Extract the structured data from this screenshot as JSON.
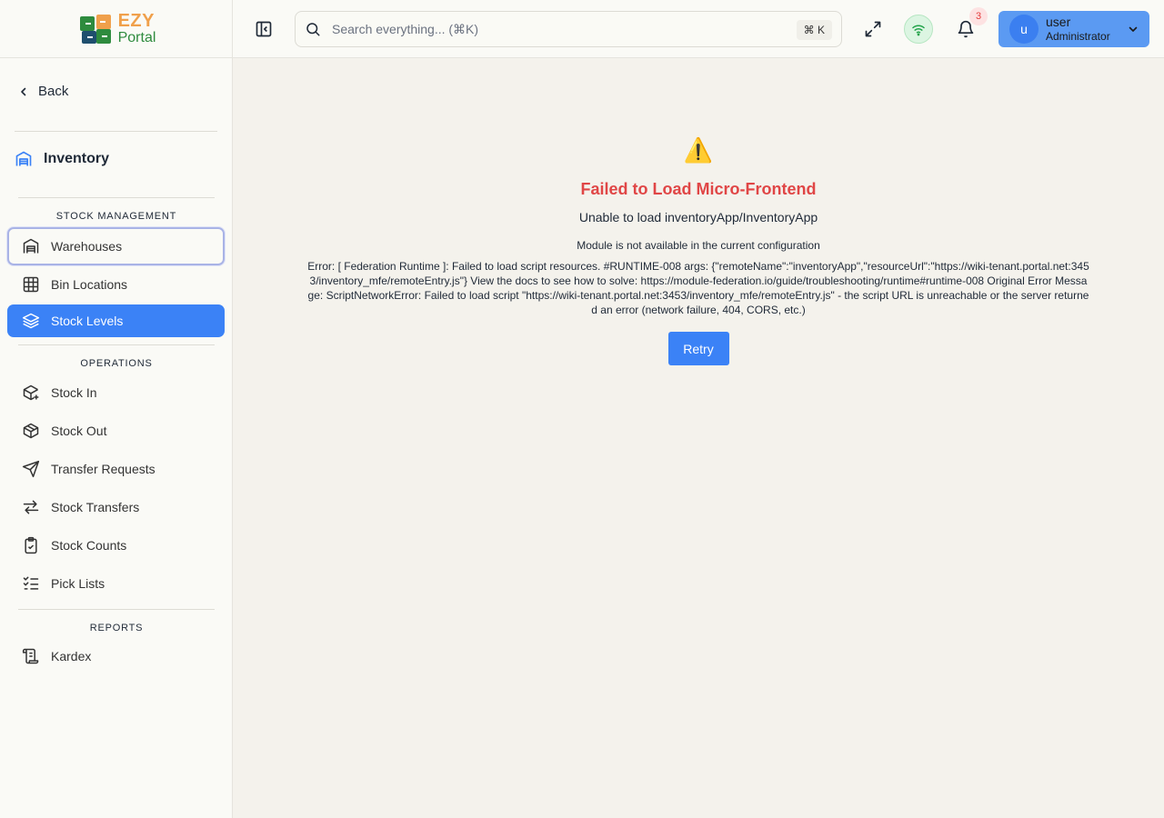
{
  "logo": {
    "ezy": "EZY",
    "portal": "Portal"
  },
  "sidebar": {
    "back_label": "Back",
    "module_title": "Inventory",
    "sections": {
      "stock_management": "STOCK MANAGEMENT",
      "operations": "OPERATIONS",
      "reports": "REPORTS"
    },
    "items": [
      {
        "label": "Warehouses",
        "icon": "warehouse-icon"
      },
      {
        "label": "Bin Locations",
        "icon": "grid-icon"
      },
      {
        "label": "Stock Levels",
        "icon": "layers-icon"
      },
      {
        "label": "Stock In",
        "icon": "package-plus-icon"
      },
      {
        "label": "Stock Out",
        "icon": "package-icon"
      },
      {
        "label": "Transfer Requests",
        "icon": "send-icon"
      },
      {
        "label": "Stock Transfers",
        "icon": "arrows-icon"
      },
      {
        "label": "Stock Counts",
        "icon": "clipboard-check-icon"
      },
      {
        "label": "Pick Lists",
        "icon": "list-checks-icon"
      },
      {
        "label": "Kardex",
        "icon": "scroll-icon"
      }
    ]
  },
  "header": {
    "search_placeholder": "Search everything... (⌘K)",
    "shortcut": "⌘ K",
    "notification_count": "3",
    "user_initial": "u",
    "user_name": "user",
    "user_role": "Administrator"
  },
  "error": {
    "title": "Failed to Load Micro-Frontend",
    "subtitle": "Unable to load inventoryApp/InventoryApp",
    "module_message": "Module is not available in the current configuration",
    "detail": "Error: [ Federation Runtime ]: Failed to load script resources. #RUNTIME-008 args: {\"remoteName\":\"inventoryApp\",\"resourceUrl\":\"https://wiki-tenant.portal.net:3453/inventory_mfe/remoteEntry.js\"} View the docs to see how to solve: https://module-federation.io/guide/troubleshooting/runtime#runtime-008 Original Error Message: ScriptNetworkError: Failed to load script \"https://wiki-tenant.portal.net:3453/inventory_mfe/remoteEntry.js\" - the script URL is unreachable or the server returned an error (network failure, 404, CORS, etc.)",
    "retry_label": "Retry"
  },
  "colors": {
    "accent": "#3b82f6",
    "error": "#e04646",
    "logo_orange": "#f0a04b",
    "logo_green": "#2e8b3e"
  }
}
